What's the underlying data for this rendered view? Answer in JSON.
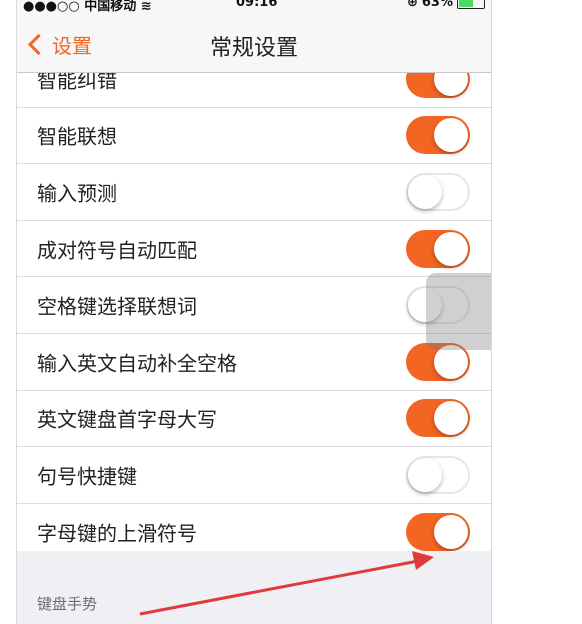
{
  "status_bar": {
    "carrier": "●●●○○ 中国移动",
    "wifi_icon": "wifi-icon",
    "time": "09:16",
    "lock_icon": "rotation-lock-icon",
    "battery_percent": "63%",
    "battery_level": 0.63
  },
  "nav": {
    "back_label": "设置",
    "title": "常规设置"
  },
  "settings": [
    {
      "label": "智能纠错",
      "on": true
    },
    {
      "label": "智能联想",
      "on": true
    },
    {
      "label": "输入预测",
      "on": false
    },
    {
      "label": "成对符号自动匹配",
      "on": true
    },
    {
      "label": "空格键选择联想词",
      "on": false
    },
    {
      "label": "输入英文自动补全空格",
      "on": true
    },
    {
      "label": "英文键盘首字母大写",
      "on": true
    },
    {
      "label": "句号快捷键",
      "on": false
    },
    {
      "label": "字母键的上滑符号",
      "on": true
    }
  ],
  "section": {
    "header": "键盘手势"
  },
  "colors": {
    "accent": "#f26522",
    "annotation_arrow": "#e03a3a"
  }
}
